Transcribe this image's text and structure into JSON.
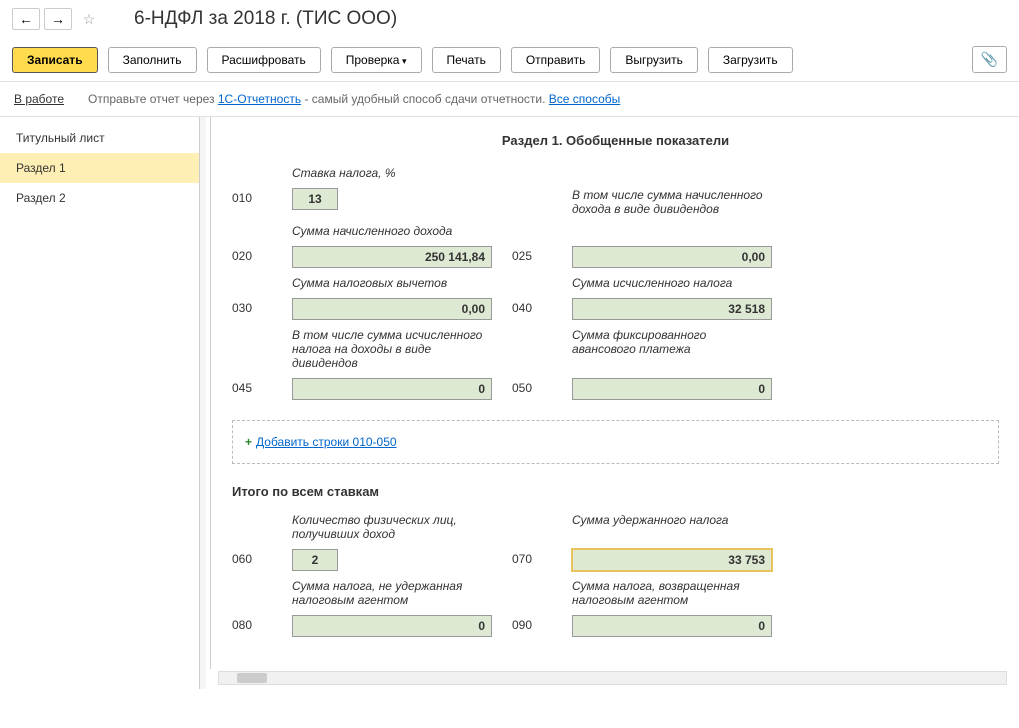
{
  "header": {
    "title": "6-НДФЛ за 2018 г. (ТИС ООО)"
  },
  "toolbar": {
    "save": "Записать",
    "fill": "Заполнить",
    "decode": "Расшифровать",
    "check": "Проверка",
    "print": "Печать",
    "send": "Отправить",
    "export": "Выгрузить",
    "import": "Загрузить"
  },
  "info": {
    "status": "В работе",
    "text1": "Отправьте отчет через ",
    "link1": "1С-Отчетность",
    "text2": " - самый удобный способ сдачи отчетности. ",
    "link2": "Все способы"
  },
  "sidebar": {
    "items": [
      "Титульный лист",
      "Раздел 1",
      "Раздел 2"
    ]
  },
  "section1": {
    "title": "Раздел 1. Обобщенные показатели",
    "labels": {
      "rate": "Ставка налога, %",
      "income": "Сумма начисленного дохода",
      "dividends": "В том числе сумма начисленного дохода в виде дивидендов",
      "deductions": "Сумма налоговых вычетов",
      "taxCalc": "Сумма исчисленного налога",
      "taxDiv": "В том числе сумма исчисленного налога на доходы в виде дивидендов",
      "fixed": "Сумма фиксированного авансового платежа"
    },
    "codes": {
      "c010": "010",
      "c020": "020",
      "c025": "025",
      "c030": "030",
      "c040": "040",
      "c045": "045",
      "c050": "050"
    },
    "values": {
      "v010": "13",
      "v020": "250 141,84",
      "v025": "0,00",
      "v030": "0,00",
      "v040": "32 518",
      "v045": "0",
      "v050": "0"
    },
    "addLink": "Добавить строки 010-050"
  },
  "totals": {
    "title": "Итого по всем ставкам",
    "labels": {
      "persons": "Количество физических лиц, получивших доход",
      "withheld": "Сумма удержанного налога",
      "notWithheld": "Сумма налога, не удержанная налоговым агентом",
      "returned": "Сумма налога, возвращенная налоговым агентом"
    },
    "codes": {
      "c060": "060",
      "c070": "070",
      "c080": "080",
      "c090": "090"
    },
    "values": {
      "v060": "2",
      "v070": "33 753",
      "v080": "0",
      "v090": "0"
    }
  }
}
